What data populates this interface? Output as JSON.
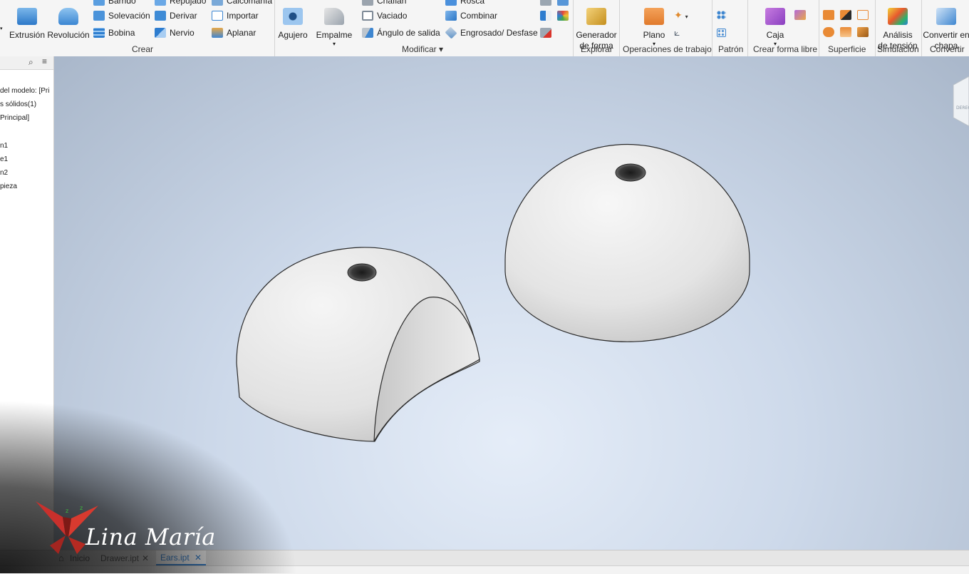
{
  "ribbon": {
    "create": {
      "group_label": "Crear",
      "extrusion": "Extrusión",
      "revolucion": "Revolución",
      "barrido": "Barrido",
      "solevacion": "Solevación",
      "bobina": "Bobina",
      "repujado": "Repujado",
      "derivar": "Derivar",
      "nervio": "Nervio",
      "calcomania": "Calcomanía",
      "importar": "Importar",
      "aplanar": "Aplanar"
    },
    "modify": {
      "group_label": "Modificar ▾",
      "agujero": "Agujero",
      "empalme": "Empalme",
      "chaflan": "Chaflán",
      "vaciado": "Vaciado",
      "angulo_salida": "Ángulo de salida",
      "rosca": "Rosca",
      "combinar": "Combinar",
      "engrosado": "Engrosado/ Desfase"
    },
    "explore": {
      "group_label": "Explorar",
      "generador_1": "Generador",
      "generador_2": "de forma"
    },
    "work_features": {
      "group_label": "Operaciones de trabajo",
      "plano": "Plano"
    },
    "pattern": {
      "group_label": "Patrón"
    },
    "freeform": {
      "group_label": "Crear forma libre",
      "caja": "Caja"
    },
    "surface": {
      "group_label": "Superficie"
    },
    "simulation": {
      "group_label": "Simulación",
      "analisis_1": "Análisis",
      "analisis_2": "de tensión"
    },
    "convert": {
      "group_label": "Convertir",
      "convertir_1": "Convertir en",
      "convertir_2": "chapa"
    }
  },
  "browser": {
    "items": [
      "del modelo: [Pri",
      "s sólidos(1)",
      "Principal]",
      "n1",
      "e1",
      "n2",
      "pieza"
    ]
  },
  "tabs": {
    "inicio": "Inicio",
    "drawer": "Drawer.ipt",
    "ears": "Ears.ipt",
    "close": "✕"
  },
  "watermark": {
    "text": "Lina María"
  },
  "colors": {
    "accent": "#2e7fd3",
    "viewport_top": "#a9b7ca",
    "viewport_bottom": "#e5edf8",
    "ribbon_bg": "#f5f5f5"
  }
}
